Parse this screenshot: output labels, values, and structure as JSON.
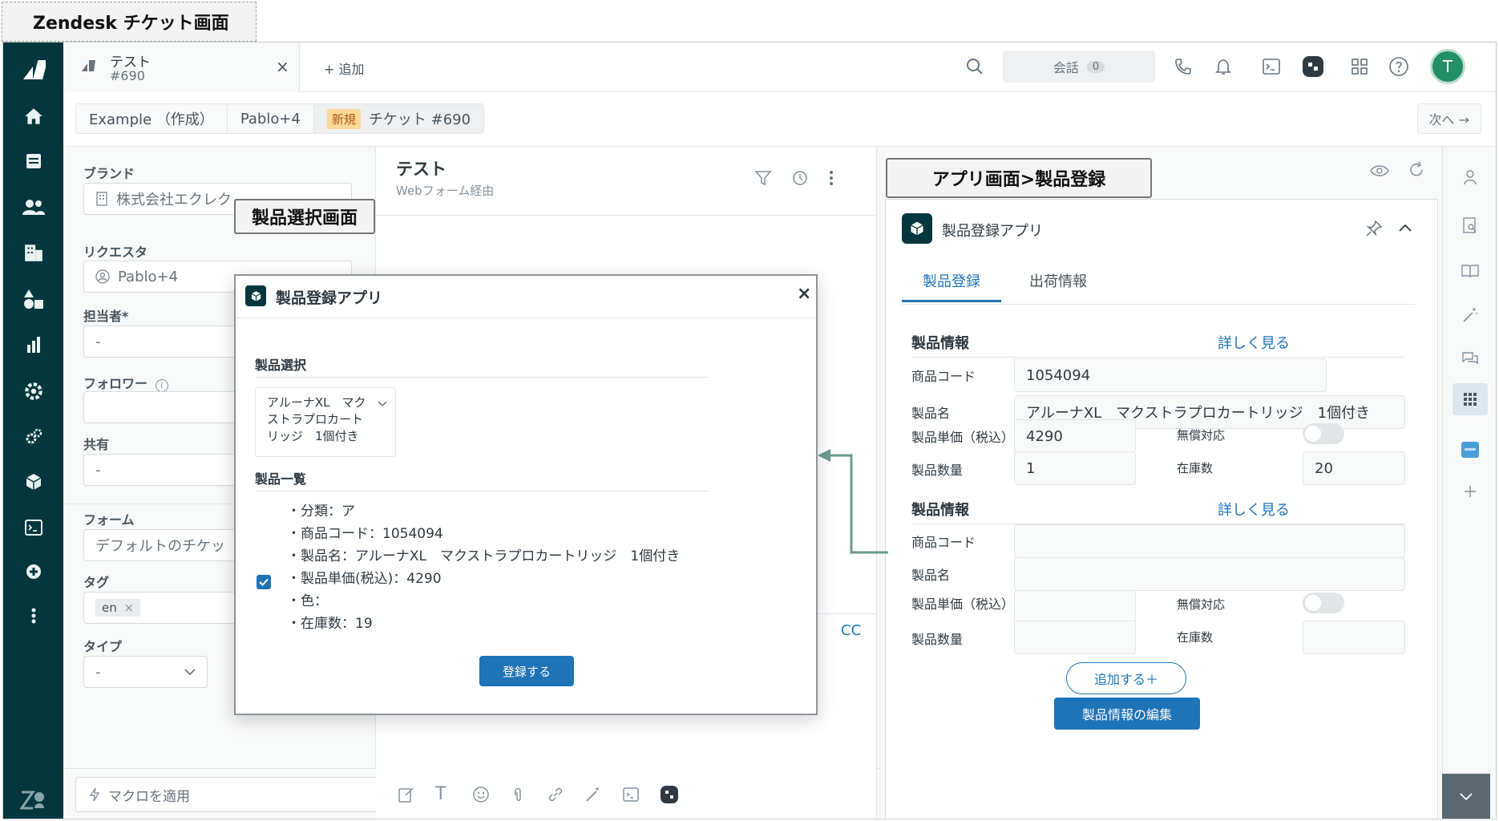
{
  "caption": "Zendesk チケット画面",
  "header": {
    "ticket_tab_title": "テスト",
    "ticket_tab_number": "#690",
    "add_label": "+ 追加",
    "conversations_label": "会話",
    "conversations_count": "0",
    "avatar_initial": "T"
  },
  "breadcrumb": {
    "org": "Example （作成）",
    "requester": "Pablo+4",
    "status_badge": "新規",
    "ticket": "チケット #690",
    "next_label": "次へ →"
  },
  "properties": {
    "brand_label": "ブランド",
    "brand_value": "株式会社エクレク",
    "requester_label": "リクエスタ",
    "requester_value": "Pablo+4",
    "assignee_label": "担当者*",
    "assignee_value": "-",
    "followers_label": "フォロワー",
    "share_label": "共有",
    "share_value": "-",
    "form_label": "フォーム",
    "form_value": "デフォルトのチケッ",
    "tags_label": "タグ",
    "tag_value": "en",
    "type_label": "タイプ",
    "type_value": "-",
    "macro_placeholder": "マクロを適用"
  },
  "conversation": {
    "title": "テスト",
    "subtitle": "Webフォーム経由",
    "cc_label": "CC"
  },
  "annotations": {
    "modal_caption": "製品選択画面",
    "app_caption": "アプリ画面>製品登録"
  },
  "modal": {
    "title": "製品登録アプリ",
    "select_label": "製品選択",
    "select_value": "アルーナXL　マクストラプロカートリッジ　1個付き",
    "list_label": "製品一覧",
    "items": [
      "・分類：ア",
      "・商品コード：1054094",
      "・製品名：アルーナXL　マクストラプロカートリッジ　1個付き",
      "・製品単価(税込)：4290",
      "・色：",
      "・在庫数：19"
    ],
    "register_button": "登録する"
  },
  "app": {
    "title": "製品登録アプリ",
    "tabs": [
      "製品登録",
      "出荷情報"
    ],
    "section1": {
      "title": "製品情報",
      "more": "詳しく見る",
      "code_label": "商品コード",
      "code_value": "1054094",
      "name_label": "製品名",
      "name_value": "アルーナXL　マクストラプロカートリッジ　1個付き",
      "price_label": "製品単価（税込）",
      "price_value": "4290",
      "free_label": "無償対応",
      "qty_label": "製品数量",
      "qty_value": "1",
      "stock_label": "在庫数",
      "stock_value": "20"
    },
    "section2": {
      "title": "製品情報",
      "more": "詳しく見る",
      "code_label": "商品コード",
      "name_label": "製品名",
      "price_label": "製品単価（税込）",
      "free_label": "無償対応",
      "qty_label": "製品数量",
      "stock_label": "在庫数"
    },
    "add_button": "追加する＋",
    "edit_button": "製品情報の編集"
  },
  "colors": {
    "rail": "#03363d",
    "primary": "#1f73b7",
    "arrow": "#6a9a8f",
    "badge_new": "#fdd997"
  }
}
